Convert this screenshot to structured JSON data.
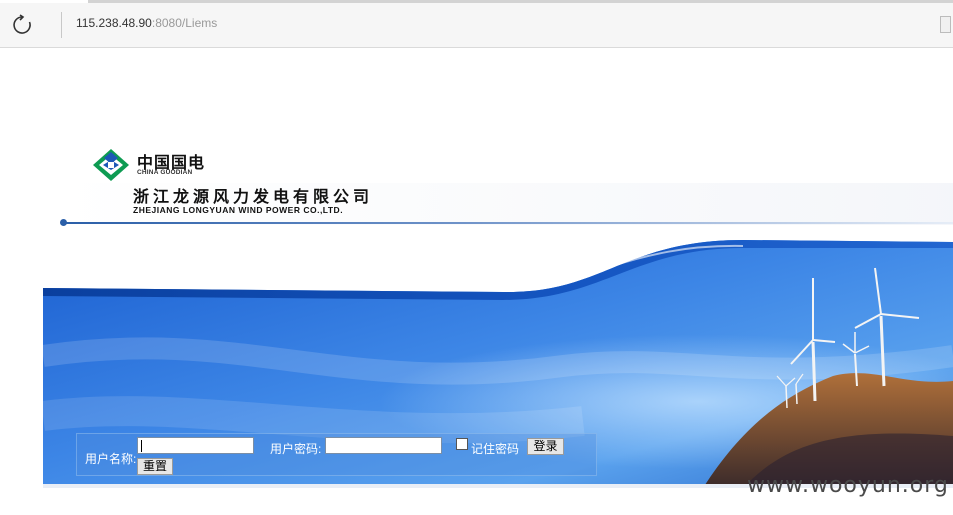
{
  "browser": {
    "url_host": "115.238.48.90",
    "url_rest": ":8080/Liems"
  },
  "header": {
    "brand_cn": "中国国电",
    "brand_en": "CHINA GUODIAN",
    "company_cn": "浙江龙源风力发电有限公司",
    "company_en": "ZHEJIANG LONGYUAN WIND POWER CO.,LTD."
  },
  "login": {
    "username_label": "用户名称:",
    "password_label": "用户密码:",
    "username_value": "",
    "password_value": "",
    "remember_label": "记住密码",
    "remember_checked": false,
    "login_button": "登录",
    "reset_button": "重置"
  },
  "watermark": "www.wooyun.org",
  "colors": {
    "banner_blue": "#1e5ec8",
    "banner_dark": "#0a3f9e",
    "header_line": "#2b5fa8"
  },
  "icons": [
    "reload-icon",
    "china-guodian-logo",
    "tabs-icon"
  ]
}
